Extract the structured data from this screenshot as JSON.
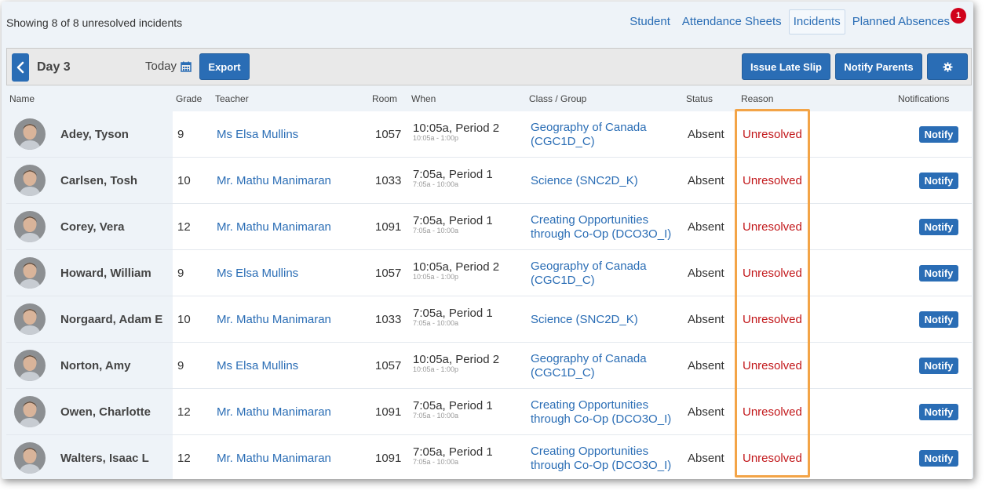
{
  "summary": "Showing 8 of 8 unresolved incidents",
  "nav": {
    "tabs": [
      {
        "label": "Student"
      },
      {
        "label": "Attendance Sheets"
      },
      {
        "label": "Incidents"
      },
      {
        "label": "Planned Absences"
      }
    ],
    "badge_count": "1"
  },
  "toolbar": {
    "day": "Day 3",
    "today": "Today",
    "export": "Export",
    "issue_late_slip": "Issue Late Slip",
    "notify_parents": "Notify Parents"
  },
  "columns": {
    "name": "Name",
    "grade": "Grade",
    "teacher": "Teacher",
    "room": "Room",
    "when": "When",
    "class": "Class / Group",
    "status": "Status",
    "reason": "Reason",
    "notifications": "Notifications"
  },
  "colors": {
    "accent": "#2a6db5",
    "unresolved": "#c2181b",
    "highlight": "#f3a447",
    "badge": "#d0021b"
  },
  "rows": [
    {
      "name": "Adey, Tyson",
      "grade": "9",
      "teacher": "Ms Elsa Mullins",
      "room": "1057",
      "when": "10:05a, Period 2",
      "when_sub": "10:05a - 1:00p",
      "class_l1": "Geography of Canada",
      "class_l2": "(CGC1D_C)",
      "status": "Absent",
      "reason": "Unresolved",
      "notify": "Notify"
    },
    {
      "name": "Carlsen, Tosh",
      "grade": "10",
      "teacher": "Mr. Mathu Manimaran",
      "room": "1033",
      "when": "7:05a, Period 1",
      "when_sub": "7:05a - 10:00a",
      "class_l1": "Science (SNC2D_K)",
      "class_l2": "",
      "status": "Absent",
      "reason": "Unresolved",
      "notify": "Notify"
    },
    {
      "name": "Corey, Vera",
      "grade": "12",
      "teacher": "Mr. Mathu Manimaran",
      "room": "1091",
      "when": "7:05a, Period 1",
      "when_sub": "7:05a - 10:00a",
      "class_l1": "Creating Opportunities",
      "class_l2": "through Co-Op (DCO3O_I)",
      "status": "Absent",
      "reason": "Unresolved",
      "notify": "Notify"
    },
    {
      "name": "Howard, William",
      "grade": "9",
      "teacher": "Ms Elsa Mullins",
      "room": "1057",
      "when": "10:05a, Period 2",
      "when_sub": "10:05a - 1:00p",
      "class_l1": "Geography of Canada",
      "class_l2": "(CGC1D_C)",
      "status": "Absent",
      "reason": "Unresolved",
      "notify": "Notify"
    },
    {
      "name": "Norgaard, Adam E",
      "grade": "10",
      "teacher": "Mr. Mathu Manimaran",
      "room": "1033",
      "when": "7:05a, Period 1",
      "when_sub": "7:05a - 10:00a",
      "class_l1": "Science (SNC2D_K)",
      "class_l2": "",
      "status": "Absent",
      "reason": "Unresolved",
      "notify": "Notify"
    },
    {
      "name": "Norton, Amy",
      "grade": "9",
      "teacher": "Ms Elsa Mullins",
      "room": "1057",
      "when": "10:05a, Period 2",
      "when_sub": "10:05a - 1:00p",
      "class_l1": "Geography of Canada",
      "class_l2": "(CGC1D_C)",
      "status": "Absent",
      "reason": "Unresolved",
      "notify": "Notify"
    },
    {
      "name": "Owen, Charlotte",
      "grade": "12",
      "teacher": "Mr. Mathu Manimaran",
      "room": "1091",
      "when": "7:05a, Period 1",
      "when_sub": "7:05a - 10:00a",
      "class_l1": "Creating Opportunities",
      "class_l2": "through Co-Op (DCO3O_I)",
      "status": "Absent",
      "reason": "Unresolved",
      "notify": "Notify"
    },
    {
      "name": "Walters, Isaac L",
      "grade": "12",
      "teacher": "Mr. Mathu Manimaran",
      "room": "1091",
      "when": "7:05a, Period 1",
      "when_sub": "7:05a - 10:00a",
      "class_l1": "Creating Opportunities",
      "class_l2": "through Co-Op (DCO3O_I)",
      "status": "Absent",
      "reason": "Unresolved",
      "notify": "Notify"
    }
  ]
}
